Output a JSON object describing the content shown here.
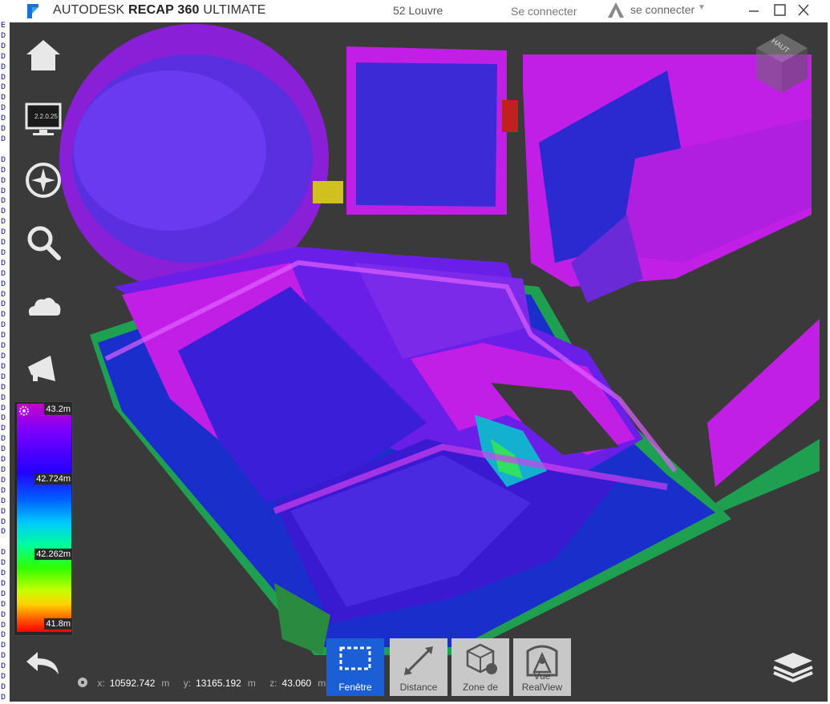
{
  "titlebar": {
    "app_name_prefix": "AUTODESK",
    "app_name_bold": "RECAP 360",
    "app_name_suffix": "ULTIMATE",
    "project_name": "52 Louvre",
    "sign_in_link": "Se connecter",
    "account_sign_in": "se connecter",
    "account_icon": "autodesk-a360-icon",
    "window_buttons": [
      "minimize-icon",
      "maximize-icon",
      "close-icon"
    ]
  },
  "left_strip": {
    "letters": [
      "E",
      "D",
      "D",
      "D",
      "D",
      "D",
      "D",
      "D",
      "D",
      "D",
      "D",
      "D",
      "",
      "D",
      "D",
      "D",
      "D",
      "D",
      "D",
      "D",
      "D",
      "D",
      "D",
      "D",
      "D",
      "D",
      "D",
      "D",
      "D",
      "D",
      "D",
      "D",
      "D",
      "D",
      "D",
      "D",
      "D",
      "D",
      "D",
      "D",
      "D",
      "D",
      "D",
      "D",
      "D",
      "D",
      "D",
      "D",
      "D",
      "D",
      "",
      "D",
      "D",
      "D",
      "D",
      "D",
      "D",
      "D",
      "D",
      "D",
      "D",
      "D",
      "D",
      "D",
      "D",
      "D",
      "D"
    ]
  },
  "sidebar": {
    "icons": [
      "home-icon",
      "monitor-icon",
      "navigation-compass-icon",
      "zoom-icon",
      "cloud-icon",
      "megaphone-icon"
    ],
    "monitor_version": "2.2.0.25"
  },
  "elevation_scale": {
    "labels": [
      "43.2m",
      "42.724m",
      "42.262m",
      "41.8m"
    ],
    "settings_icon": "gear-icon"
  },
  "coordinates": {
    "icon": "crosshair-icon",
    "x_label": "x:",
    "x_value": "10592.742",
    "x_unit": "m",
    "y_label": "y:",
    "y_value": "13165.192",
    "y_unit": "m",
    "z_label": "z:",
    "z_value": "43.060",
    "z_unit": "m"
  },
  "toolbar": {
    "buttons": [
      {
        "label": "Fenêtre",
        "icon": "window-select-icon",
        "active": true
      },
      {
        "label": "Distance",
        "icon": "distance-measure-icon",
        "active": false
      },
      {
        "label": "Zone de",
        "icon": "region-edit-icon",
        "active": false
      },
      {
        "label": "Vue RealView",
        "icon": "realview-icon",
        "active": false
      }
    ]
  },
  "navigation": {
    "back_icon": "undo-arrow-icon",
    "layers_icon": "layers-icon",
    "viewcube_label": "HAUT"
  },
  "colors": {
    "viewport_bg": "#3a3a3a",
    "active_tool": "#1b5fd6",
    "tool_bg": "#c8c8c8",
    "cloud_magenta": "#c21fe6",
    "cloud_violet": "#6a1fe8",
    "cloud_blue": "#3a1ad0"
  }
}
